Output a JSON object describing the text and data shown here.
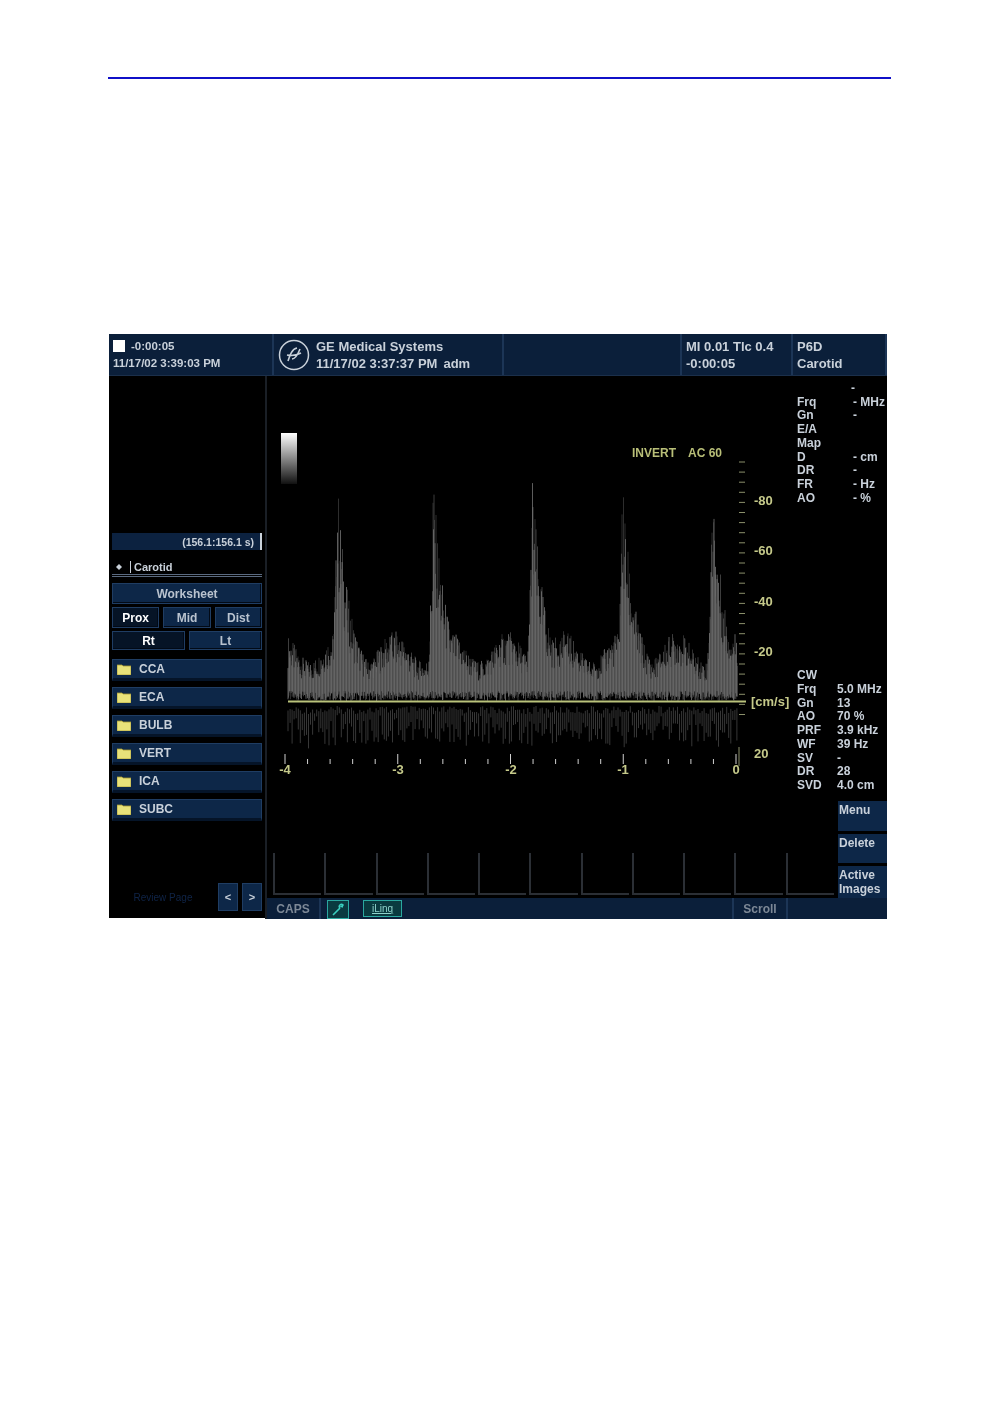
{
  "header": {
    "clock": "-0:00:05",
    "date": "11/17/02 3:39:03 PM",
    "system": "GE Medical Systems",
    "exam_time": "11/17/02 3:37:37 PM",
    "user": "adm",
    "mi": "MI 0.01 Tlc 0.4",
    "elapsed": "-0:00:05",
    "probe": "P6D",
    "preset": "Carotid"
  },
  "left_panel": {
    "cine_range": "(156.1:156.1 s)",
    "protocol": "Carotid",
    "worksheet": "Worksheet",
    "locations": [
      {
        "label": "Prox",
        "selected": true
      },
      {
        "label": "Mid",
        "selected": false
      },
      {
        "label": "Dist",
        "selected": false
      }
    ],
    "sides": [
      {
        "label": "Rt",
        "selected": true
      },
      {
        "label": "Lt",
        "selected": false
      }
    ],
    "folders": [
      "CCA",
      "ECA",
      "BULB",
      "VERT",
      "ICA",
      "SUBC"
    ],
    "review_page": "Review Page",
    "nav": [
      "<",
      ">"
    ]
  },
  "display": {
    "mode": [
      "INVERT",
      "AC 60"
    ],
    "velocity_ticks": [
      "-80",
      "-60",
      "-40",
      "-20",
      "[cm/s]",
      "20"
    ],
    "time_ticks": [
      "-4",
      "-3",
      "-2",
      "-1",
      "0"
    ]
  },
  "params_2d": {
    "top": "-",
    "rows": [
      {
        "label": "Frq",
        "value": "- MHz"
      },
      {
        "label": "Gn",
        "value": "-"
      },
      {
        "label": "E/A"
      },
      {
        "label": "Map"
      },
      {
        "label": "D",
        "value": "- cm"
      },
      {
        "label": "DR",
        "value": "-"
      },
      {
        "label": "FR",
        "value": "- Hz"
      },
      {
        "label": "AO",
        "value": "- %"
      }
    ]
  },
  "params_cw": {
    "title": "CW",
    "rows": [
      {
        "label": "Frq",
        "value": "5.0 MHz"
      },
      {
        "label": "Gn",
        "value": "13"
      },
      {
        "label": "AO",
        "value": "70 %"
      },
      {
        "label": "PRF",
        "value": "3.9 kHz"
      },
      {
        "label": "WF",
        "value": "39 Hz"
      },
      {
        "label": "SV",
        "value": "-"
      },
      {
        "label": "DR",
        "value": "28"
      },
      {
        "label": "SVD",
        "value": "4.0 cm"
      }
    ]
  },
  "softkeys": [
    "Menu",
    "Delete",
    "Active Images"
  ],
  "status_bar": [
    {
      "kind": "text",
      "label": "CAPS"
    },
    {
      "kind": "wrench"
    },
    {
      "kind": "link",
      "label": "iLinq"
    },
    {
      "kind": "spacer"
    },
    {
      "kind": "text",
      "label": "Scroll"
    },
    {
      "kind": "spacer"
    }
  ]
}
